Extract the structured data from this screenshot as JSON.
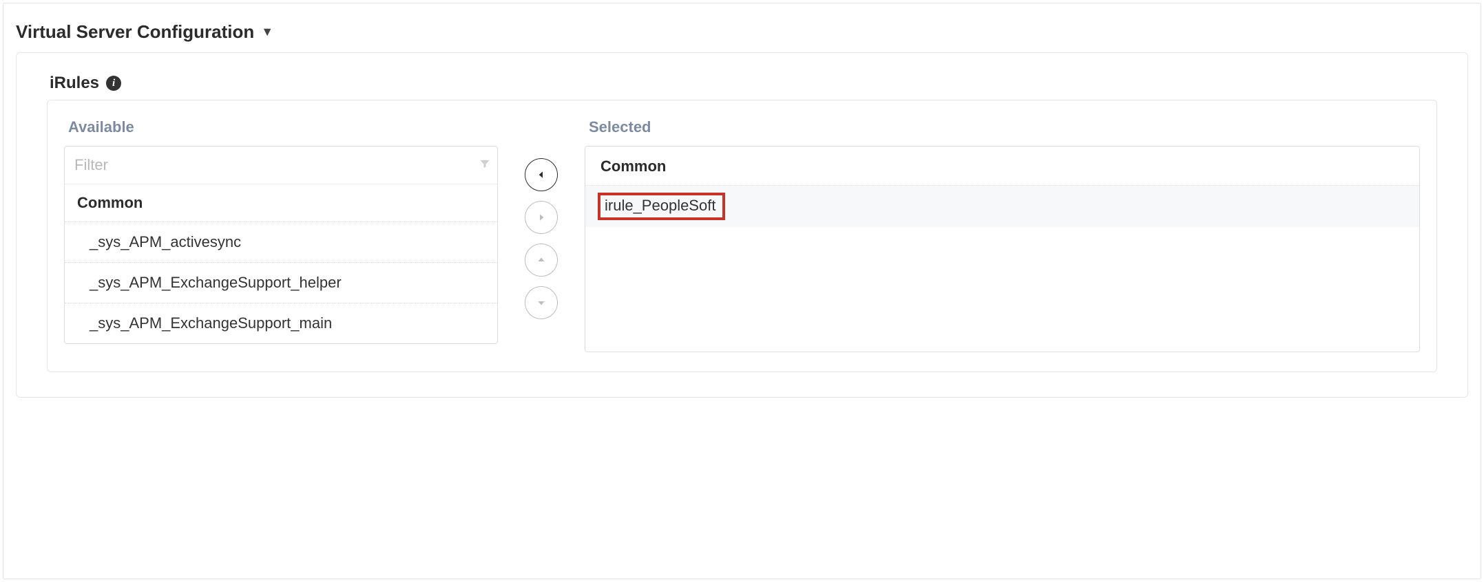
{
  "section": {
    "title": "Virtual Server Configuration"
  },
  "irules": {
    "label": "iRules",
    "available": {
      "label": "Available",
      "filterPlaceholder": "Filter",
      "group": "Common",
      "items": [
        "_sys_APM_activesync",
        "_sys_APM_ExchangeSupport_helper",
        "_sys_APM_ExchangeSupport_main"
      ]
    },
    "selected": {
      "label": "Selected",
      "group": "Common",
      "items": [
        "irule_PeopleSoft"
      ]
    }
  }
}
